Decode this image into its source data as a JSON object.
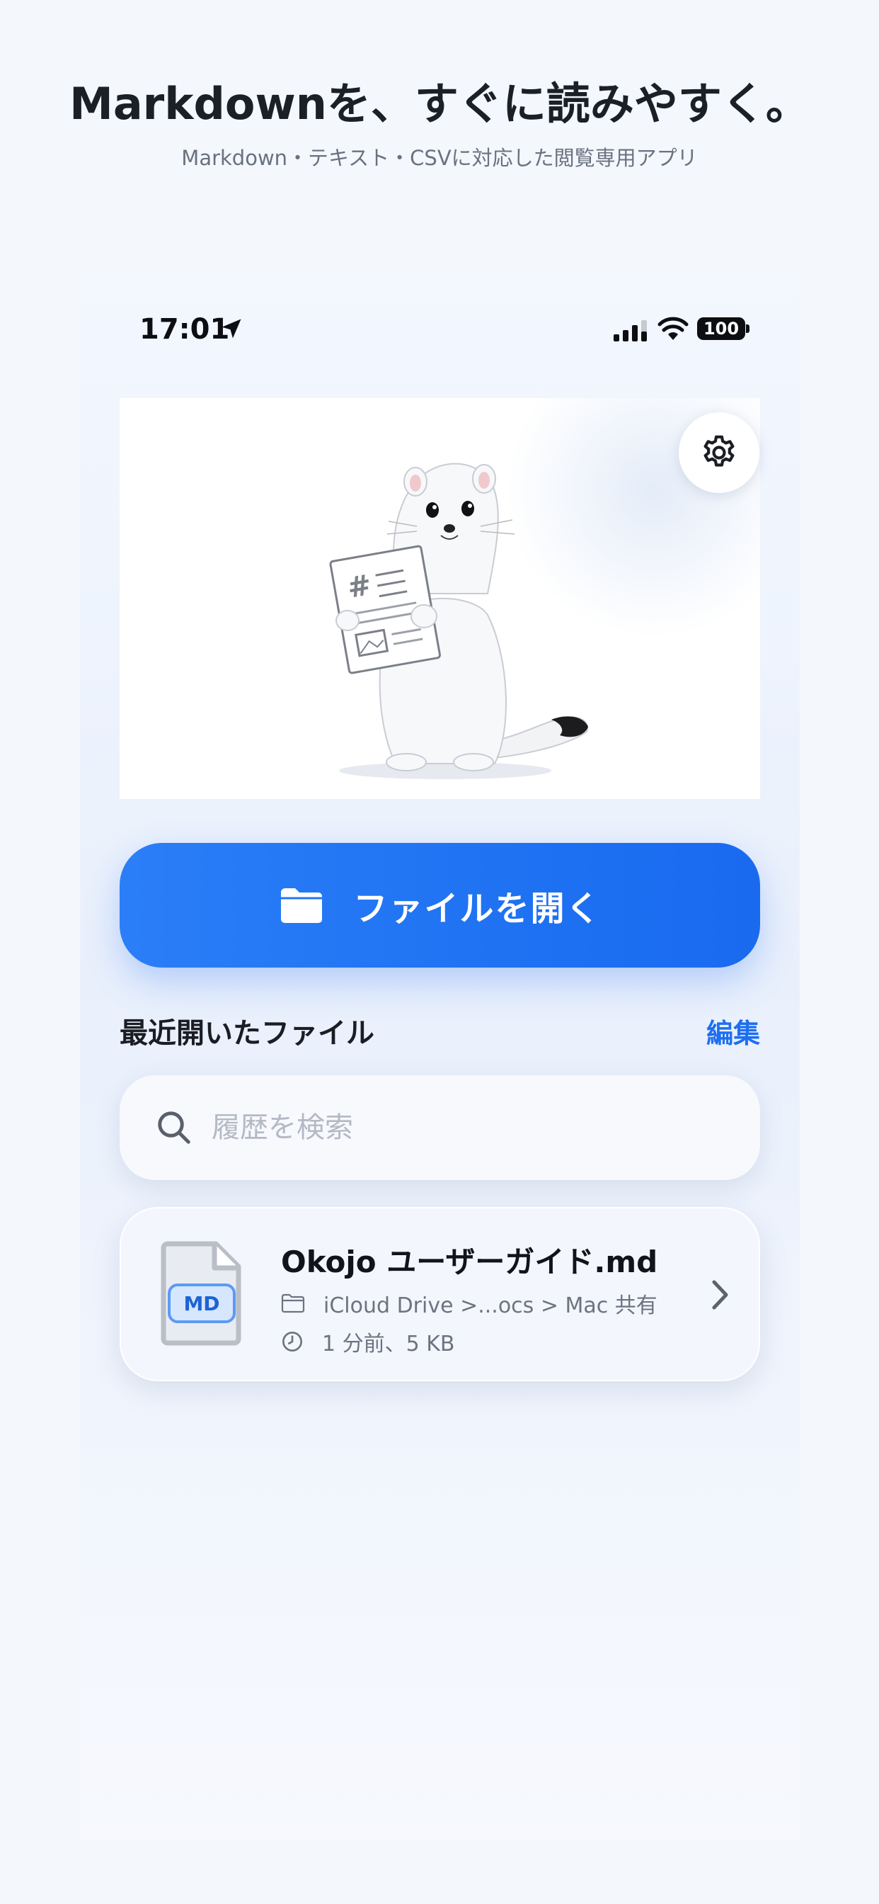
{
  "promo": {
    "headline": "Markdownを、すぐに読みやすく。",
    "subline": "Markdown・テキスト・CSVに対応した閲覧専用アプリ"
  },
  "status_bar": {
    "time": "17:01",
    "battery": "100"
  },
  "home": {
    "open_button_label": "ファイルを開く",
    "recent_title": "最近開いたファイル",
    "edit_label": "編集",
    "search_placeholder": "履歴を検索"
  },
  "recent_files": [
    {
      "name": "Okojo ユーザーガイド.md",
      "badge": "MD",
      "location": "iCloud Drive >...ocs > Mac 共有",
      "details": "1 分前、5 KB"
    }
  ],
  "colors": {
    "accent": "#1f72f2",
    "background": "#f4f7fc"
  },
  "icons": [
    "location-arrow-icon",
    "signal-icon",
    "wifi-icon",
    "gear-icon",
    "folder-icon",
    "search-icon",
    "md-file-icon",
    "small-folder-icon",
    "clock-icon",
    "chevron-right-icon"
  ]
}
